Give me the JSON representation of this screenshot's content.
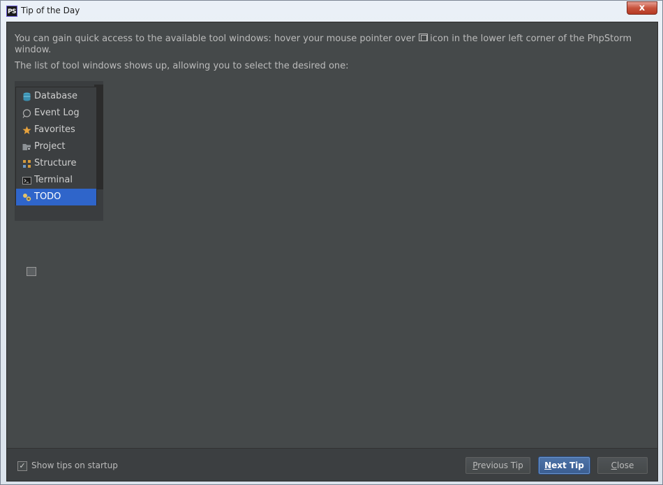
{
  "window": {
    "app_icon_text": "PS",
    "title": "Tip of the Day",
    "close_glyph": "x"
  },
  "tip": {
    "line1a": "You can gain quick access to the available tool windows: hover your mouse pointer over",
    "line1b": "icon in the lower left corner of the PhpStorm",
    "line2": "window.",
    "line3": "The list of tool windows shows up, allowing you to select the desired one:"
  },
  "popup": {
    "items": [
      {
        "label": "Database",
        "icon": "database-icon"
      },
      {
        "label": "Event Log",
        "icon": "event-log-icon"
      },
      {
        "label": "Favorites",
        "icon": "star-icon"
      },
      {
        "label": "Project",
        "icon": "folder-icon"
      },
      {
        "label": "Structure",
        "icon": "structure-icon"
      },
      {
        "label": "Terminal",
        "icon": "terminal-icon"
      },
      {
        "label": "TODO",
        "icon": "todo-icon",
        "selected": true
      }
    ]
  },
  "footer": {
    "show_tips_checked": true,
    "show_tips_label": "Show tips on startup",
    "previous": {
      "mnemonic": "P",
      "rest": "revious Tip"
    },
    "next": {
      "mnemonic": "N",
      "rest": "ext Tip"
    },
    "close": {
      "mnemonic": "C",
      "rest": "lose"
    }
  },
  "colors": {
    "background": "#45494a",
    "text": "#bbbbbb",
    "selection": "#2f65ca",
    "primary_button": "#3b5e91"
  }
}
